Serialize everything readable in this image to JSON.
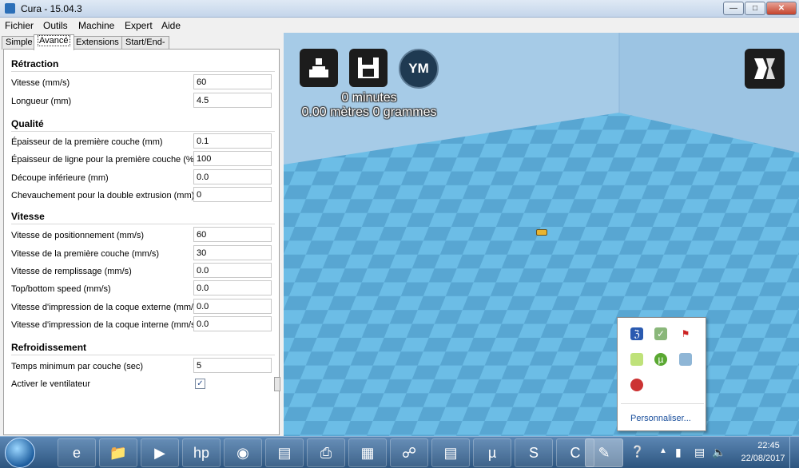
{
  "window": {
    "title": "Cura - 15.04.3"
  },
  "menu": [
    "Fichier",
    "Outils",
    "Machine",
    "Expert",
    "Aide"
  ],
  "tabs": [
    "Simple",
    "Avancé",
    "Extensions",
    "Start/End-GCode"
  ],
  "active_tab": "Avancé",
  "sections": {
    "retraction": {
      "title": "Rétraction",
      "rows": [
        {
          "label": "Vitesse (mm/s)",
          "value": "60"
        },
        {
          "label": "Longueur (mm)",
          "value": "4.5"
        }
      ]
    },
    "qualite": {
      "title": "Qualité",
      "rows": [
        {
          "label": "Épaisseur de la première couche (mm)",
          "value": "0.1"
        },
        {
          "label": "Épaisseur de ligne pour la première couche (%)",
          "value": "100"
        },
        {
          "label": "Découpe inférieure (mm)",
          "value": "0.0"
        },
        {
          "label": "Chevauchement pour la double extrusion (mm)",
          "value": "0"
        }
      ]
    },
    "vitesse": {
      "title": "Vitesse",
      "rows": [
        {
          "label": "Vitesse de positionnement (mm/s)",
          "value": "60"
        },
        {
          "label": "Vitesse de la première couche (mm/s)",
          "value": "30"
        },
        {
          "label": "Vitesse de remplissage (mm/s)",
          "value": "0.0"
        },
        {
          "label": "Top/bottom speed (mm/s)",
          "value": "0.0"
        },
        {
          "label": "Vitesse d'impression de la coque externe (mm/s)",
          "value": "0.0"
        },
        {
          "label": "Vitesse d'impression de la coque interne (mm/s)",
          "value": "0.0"
        }
      ]
    },
    "refroidissement": {
      "title": "Refroidissement",
      "rows": [
        {
          "label": "Temps minimum par couche (sec)",
          "value": "5"
        },
        {
          "label": "Activer le ventilateur",
          "checked": true
        }
      ]
    }
  },
  "viewport": {
    "ym_label": "YM",
    "print_time": "0 minutes",
    "print_cost": "0.00 mètres 0 grammes",
    "floor_colors": {
      "light": "#6cbde6",
      "dark": "#58a6d2"
    },
    "wall_color": "#a6cbe7"
  },
  "tray_popup": {
    "icons": [
      "bluetooth-icon",
      "network-check-icon",
      "flag-error-icon",
      "green-leaf-icon",
      "utorrent-icon",
      "update-icon",
      "red-app-icon"
    ],
    "customize": "Personnaliser..."
  },
  "taskbar": {
    "apps": [
      "internet-explorer-icon",
      "file-explorer-icon",
      "media-player-icon",
      "hp-icon",
      "chrome-icon",
      "document-icon",
      "printer-icon",
      "winrar-icon",
      "network-icon",
      "document-icon",
      "utorrent-icon",
      "skype-icon",
      "ccleaner-icon",
      "cura-icon"
    ],
    "time": "22:45",
    "date": "22/08/2017"
  }
}
